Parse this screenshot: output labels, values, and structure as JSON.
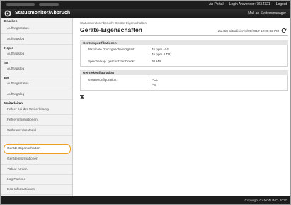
{
  "topbar": {
    "portal_label": "An Portal",
    "login_label": "Login Anwender:",
    "login_user": "7654321",
    "logout_label": "Logout"
  },
  "header": {
    "title": "Statusmonitor/Abbruch",
    "mail_link": "Mail an Systemmanager"
  },
  "sidebar": {
    "sections": [
      {
        "heading": "Drucken",
        "items": [
          "Auftragsstatus",
          "Auftragslog"
        ]
      },
      {
        "heading": "Kopie",
        "items": [
          "Auftragslog"
        ]
      },
      {
        "heading": "SE",
        "items": [
          "Auftragslog"
        ]
      },
      {
        "heading": "EM",
        "items": [
          "Auftragsstatus",
          "Auftragslog"
        ]
      },
      {
        "heading": "Weiterleiten",
        "items": [
          "Fehler bei der Weiterleitung",
          "Fehlerinformationen",
          "Verbrauchsmaterial",
          "Geräte-Eigenschaften",
          "Geräteinformationen",
          "Zähler prüfen",
          "Log Patrone",
          "Eco-Informationen"
        ]
      }
    ],
    "active_item": "Geräte-Eigenschaften"
  },
  "main": {
    "breadcrumb": "Statusmonitor/Abbruch: Geräte-Eigenschaften",
    "page_title": "Geräte-Eigenschaften",
    "last_update": "Zuletzt aktualisiert:2/09/2017 12:05:02 PM",
    "spec_group": {
      "heading": "Gerätespezifikationen",
      "speed_label": "Maximale Druckgeschwindigkeit:",
      "speed_values": [
        "45 ppm (A4)",
        "45 ppm (LTR)"
      ],
      "storage_label": "Speicherkap. geschützter Druck:",
      "storage_value": "30 MB"
    },
    "config_group": {
      "heading": "Gerätekonfiguration",
      "config_label": "Gerätekonfiguration:",
      "config_values": [
        "PCL",
        "PS"
      ]
    }
  },
  "footer": {
    "copyright": "Copyright CANON INC. 2017"
  },
  "colors": {
    "bar": "#1d1d1d",
    "active_outline": "#f0a020",
    "group_header": "#e4e4e4"
  }
}
